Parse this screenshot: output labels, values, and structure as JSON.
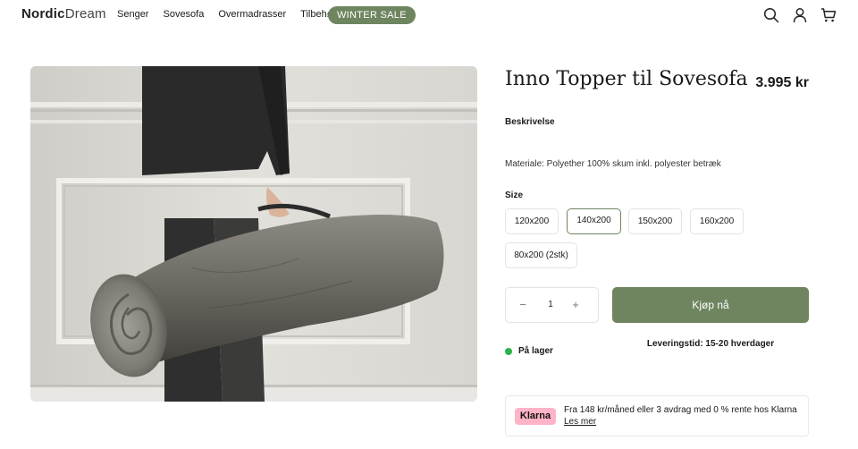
{
  "header": {
    "logo_bold": "Nordic",
    "logo_light": "Dream",
    "nav": [
      "Senger",
      "Sovesofa",
      "Overmadrasser",
      "Tilbehør"
    ],
    "sale_label": "WINTER SALE",
    "icons": [
      "search-icon",
      "user-icon",
      "cart-icon"
    ]
  },
  "product": {
    "title": "Inno Topper til Sovesofa",
    "price": "3.995 kr",
    "description_label": "Beskrivelse",
    "description": "Materiale: Polyether 100% skum inkl. polyester betræk",
    "size_label": "Size",
    "sizes": [
      "120x200",
      "140x200",
      "150x200",
      "160x200",
      "80x200 (2stk)"
    ],
    "selected_size": "140x200",
    "quantity": "1",
    "qty_minus": "−",
    "qty_plus": "+",
    "buy_label": "Kjøp nå",
    "stock_label": "På lager",
    "delivery": "Leveringstid: 15-20 hverdager"
  },
  "klarna": {
    "badge": "Klarna",
    "text": "Fra 148 kr/måned eller 3 avdrag med 0 % rente hos Klarna",
    "link": "Les mer"
  },
  "colors": {
    "accent": "#6e8560",
    "stock_dot": "#2bb24c",
    "klarna_pink": "#ffb3c7"
  }
}
